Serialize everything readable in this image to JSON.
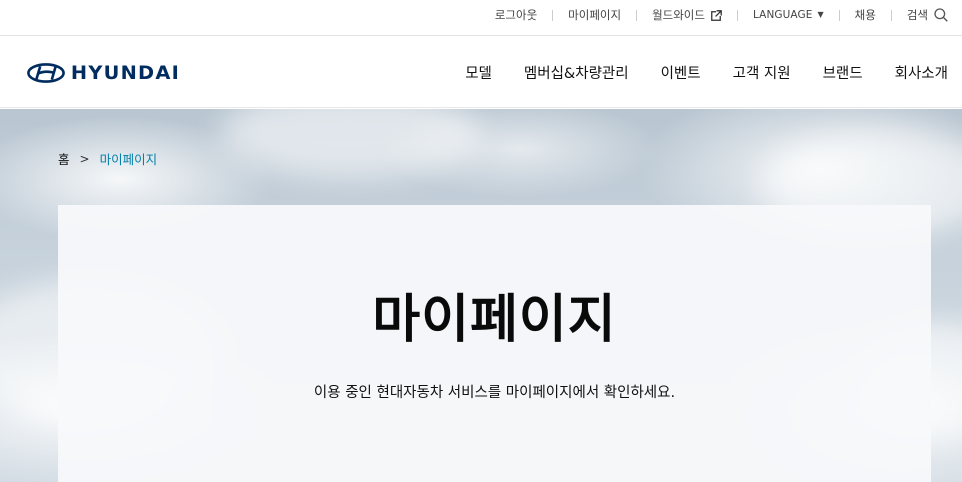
{
  "util_nav": {
    "logout": "로그아웃",
    "mypage": "마이페이지",
    "worldwide": "월드와이드",
    "language": "LANGUAGE",
    "recruit": "채용",
    "search": "검색"
  },
  "brand": {
    "logo_text": "HYUNDAI",
    "color": "#002c5f"
  },
  "gnb": {
    "items": [
      "모델",
      "멤버십&차량관리",
      "이벤트",
      "고객 지원",
      "브랜드",
      "회사소개"
    ]
  },
  "breadcrumb": {
    "home": "홈",
    "separator": ">",
    "current": "마이페이지"
  },
  "hero": {
    "title": "마이페이지",
    "description": "이용 중인 현대자동차 서비스를 마이페이지에서 확인하세요."
  },
  "colors": {
    "accent": "#007fa8",
    "brand": "#002c5f"
  }
}
